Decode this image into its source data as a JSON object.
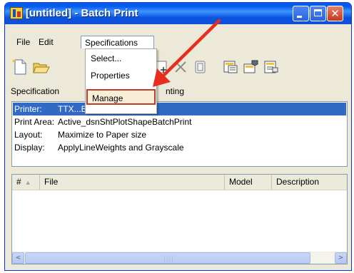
{
  "window": {
    "title": "[untitled] - Batch Print",
    "controls": {
      "minimize": "minimize-icon",
      "maximize": "maximize-icon",
      "close": "✕"
    }
  },
  "menubar": {
    "items": [
      {
        "label": "File"
      },
      {
        "label": "Edit"
      },
      {
        "label": "Specifications"
      }
    ]
  },
  "specifications_menu": {
    "items": [
      {
        "label": "Select..."
      },
      {
        "label": "Properties"
      },
      {
        "label": "Manage",
        "highlighted": true
      }
    ]
  },
  "toolbar": {
    "tools": [
      "new-file-icon",
      "open-folder-icon",
      "add-icon",
      "delete-icon",
      "panel-icon",
      "print-dialog-icon",
      "print-setup-icon",
      "print-icon"
    ]
  },
  "specifications_panel": {
    "label": "Specification",
    "label_right": "nting",
    "rows": [
      {
        "key": "Printer:",
        "value": "TTX...BW_PDF_Plots",
        "selected": true
      },
      {
        "key": "Print Area:",
        "value": "Active_dsnShtPlotShapeBatchPrint"
      },
      {
        "key": "Layout:",
        "value": "Maximize to Paper size"
      },
      {
        "key": "Display:",
        "value": "ApplyLineWeights and Grayscale"
      }
    ]
  },
  "file_list": {
    "columns": [
      {
        "label": "#",
        "sort": "▲"
      },
      {
        "label": "File"
      },
      {
        "label": "Model"
      },
      {
        "label": "Description"
      }
    ],
    "rows": [],
    "scrollbar": {
      "left": "<",
      "right": ">",
      "grip": "||||"
    }
  },
  "colors": {
    "titlebar": "#0058ee",
    "selection": "#316ac5",
    "arrow": "#e82c1e",
    "menu_highlight_border": "#c0392b"
  }
}
